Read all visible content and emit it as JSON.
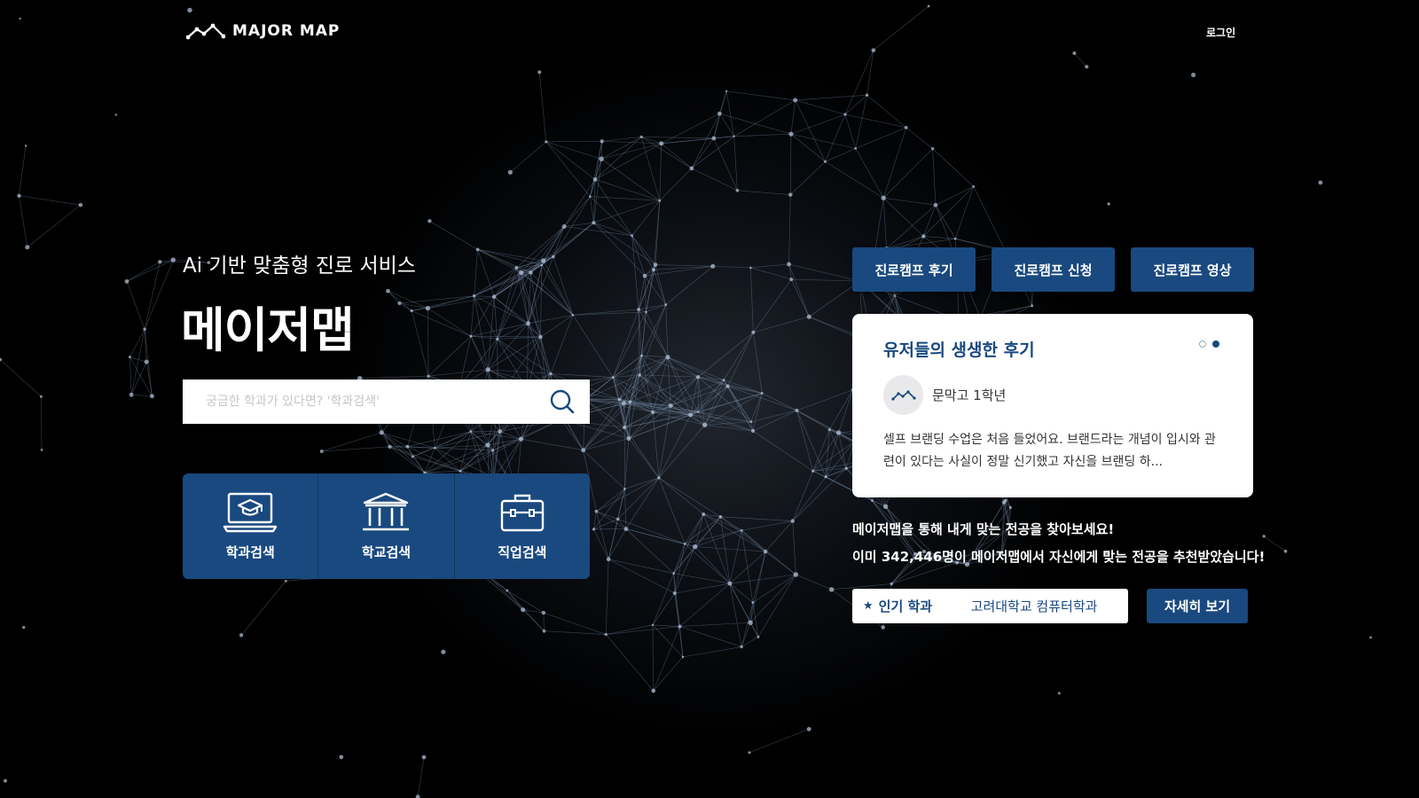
{
  "header": {
    "logo_text": "MAJOR MAP",
    "login_label": "로그인"
  },
  "hero": {
    "subtitle": "Ai 기반 맞춤형 진로 서비스",
    "title": "메이저맵",
    "search": {
      "placeholder": "궁금한 학과가 있다면? '학과검색'",
      "value": ""
    },
    "quick_menu": [
      {
        "label": "학과검색",
        "icon": "laptop-graduation-cap-icon"
      },
      {
        "label": "학교검색",
        "icon": "university-building-icon"
      },
      {
        "label": "직업검색",
        "icon": "briefcase-icon"
      }
    ]
  },
  "camp_buttons": [
    {
      "label": "진로캠프 후기"
    },
    {
      "label": "진로캠프 신청"
    },
    {
      "label": "진로캠프 영상"
    }
  ],
  "review": {
    "title": "유저들의 생생한 후기",
    "reviewer": "문막고 1학년",
    "text": "셀프 브랜딩 수업은 처음 들었어요. 브랜드라는 개념이 입시와 관련이 있다는 사실이 정말 신기했고 자신을 브랜딩 하...",
    "slides_total": 2,
    "active_slide": 2
  },
  "promo": {
    "line1": "메이저맵을 통해 내게 맞는 전공을 찾아보세요!",
    "line2": "이미 342,446명이 메이저맵에서 자신에게 맞는 전공을 추천받았습니다!"
  },
  "popular": {
    "label": "인기 학과",
    "value": "고려대학교 컴퓨터학과",
    "detail_label": "자세히 보기"
  },
  "colors": {
    "accent": "#19497f",
    "background": "#000000"
  }
}
